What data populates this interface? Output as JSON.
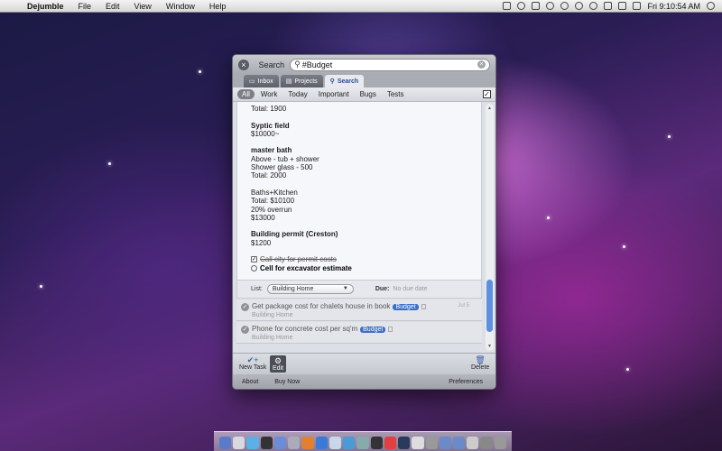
{
  "menubar": {
    "apple_glyph": "",
    "app_name": "Dejumble",
    "menus": [
      "File",
      "Edit",
      "View",
      "Window",
      "Help"
    ],
    "clock": "Fri 9:10:54 AM"
  },
  "window": {
    "search_label": "Search",
    "search_value": "#Budget",
    "tabs": [
      {
        "label": "Inbox",
        "icon": "inbox-icon"
      },
      {
        "label": "Projects",
        "icon": "projects-icon"
      },
      {
        "label": "Search",
        "icon": "search-icon"
      }
    ],
    "filters": [
      "All",
      "Work",
      "Today",
      "Important",
      "Bugs",
      "Tests"
    ],
    "notes": [
      {
        "text": "Total: 1900",
        "bold": false
      },
      {
        "text": "",
        "bold": false
      },
      {
        "text": "Syptic field",
        "bold": true
      },
      {
        "text": "$10000~",
        "bold": false
      },
      {
        "text": "",
        "bold": false
      },
      {
        "text": "master bath",
        "bold": true
      },
      {
        "text": "Above - tub + shower",
        "bold": false
      },
      {
        "text": "Shower glass - 500",
        "bold": false
      },
      {
        "text": "Total: 2000",
        "bold": false
      },
      {
        "text": "",
        "bold": false
      },
      {
        "text": "Baths+Kitchen",
        "bold": false
      },
      {
        "text": "Total: $10100",
        "bold": false
      },
      {
        "text": "20% overrun",
        "bold": false
      },
      {
        "text": "$13000",
        "bold": false
      },
      {
        "text": "",
        "bold": false
      },
      {
        "text": "Building permit (Creston)",
        "bold": true
      },
      {
        "text": "$1200",
        "bold": false
      }
    ],
    "subtasks": [
      {
        "text": "Call city for permit costs",
        "done": true
      },
      {
        "text": "Cell for excavator estimate",
        "done": false
      }
    ],
    "detail_footer": {
      "list_label": "List:",
      "list_value": "Building Home",
      "due_label": "Due:",
      "due_value": "No due date"
    },
    "tasks": [
      {
        "title": "Get package cost for chalets house in book",
        "tag": "Budget",
        "project": "Building Home",
        "date": "Jul 5"
      },
      {
        "title": "Phone for concrete cost per sq'm",
        "tag": "Budget",
        "project": "Building Home",
        "date": ""
      }
    ],
    "toolbar": {
      "new_task": "New Task",
      "edit": "Edit",
      "delete": "Delete"
    },
    "bottombar": {
      "about": "About",
      "buy_now": "Buy Now",
      "preferences": "Preferences"
    }
  },
  "colors": {
    "accent": "#3d6fc4",
    "scroll_thumb": "#5c8fe0"
  }
}
